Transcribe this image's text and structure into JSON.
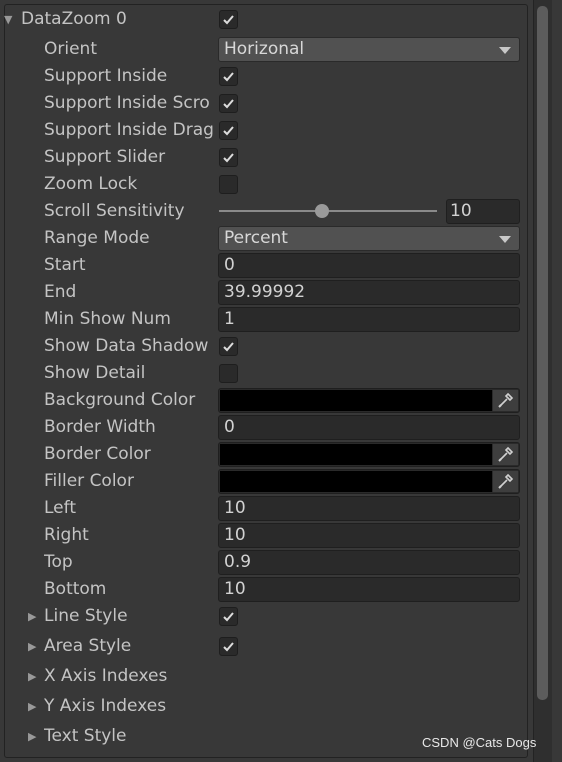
{
  "header": {
    "title": "DataZoom 0",
    "enabled": true
  },
  "fields": {
    "orient": {
      "label": "Orient",
      "value": "Horizonal"
    },
    "support_inside": {
      "label": "Support Inside",
      "checked": true
    },
    "support_inside_scroll": {
      "label": "Support Inside Scro",
      "checked": true
    },
    "support_inside_drag": {
      "label": "Support Inside Drag",
      "checked": true
    },
    "support_slider": {
      "label": "Support Slider",
      "checked": true
    },
    "zoom_lock": {
      "label": "Zoom Lock",
      "checked": false
    },
    "scroll_sensitivity": {
      "label": "Scroll Sensitivity",
      "value": "10"
    },
    "range_mode": {
      "label": "Range Mode",
      "value": "Percent"
    },
    "start": {
      "label": "Start",
      "value": "0"
    },
    "end": {
      "label": "End",
      "value": "39.99992"
    },
    "min_show_num": {
      "label": "Min Show Num",
      "value": "1"
    },
    "show_data_shadow": {
      "label": "Show Data Shadow",
      "checked": true
    },
    "show_detail": {
      "label": "Show Detail",
      "checked": false
    },
    "background_color": {
      "label": "Background Color",
      "color": "#000000"
    },
    "border_width": {
      "label": "Border Width",
      "value": "0"
    },
    "border_color": {
      "label": "Border Color",
      "color": "#000000"
    },
    "filler_color": {
      "label": "Filler Color",
      "color": "#000000"
    },
    "left": {
      "label": "Left",
      "value": "10"
    },
    "right": {
      "label": "Right",
      "value": "10"
    },
    "top": {
      "label": "Top",
      "value": "0.9"
    },
    "bottom": {
      "label": "Bottom",
      "value": "10"
    }
  },
  "subsections": {
    "line_style": {
      "label": "Line Style",
      "checked": true
    },
    "area_style": {
      "label": "Area Style",
      "checked": true
    },
    "x_axis_indexes": {
      "label": "X Axis Indexes"
    },
    "y_axis_indexes": {
      "label": "Y Axis Indexes"
    },
    "text_style": {
      "label": "Text Style"
    }
  },
  "watermark": "CSDN @Cats Dogs"
}
